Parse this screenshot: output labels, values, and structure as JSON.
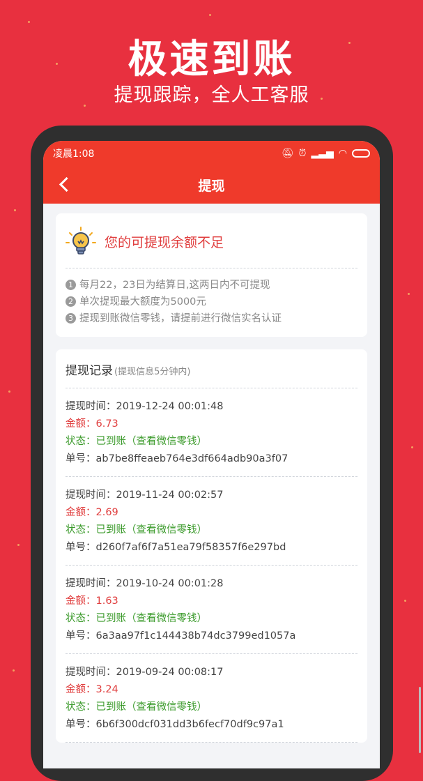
{
  "promo": {
    "title": "极速到账",
    "subtitle": "提现跟踪，全人工客服"
  },
  "statusbar": {
    "time": "凌晨1:08"
  },
  "navbar": {
    "title": "提现"
  },
  "notice": {
    "title": "您的可提现余额不足",
    "rules": [
      {
        "num": "1",
        "text": "每月22，23日为结算日,这两日内不可提现"
      },
      {
        "num": "2",
        "text": "单次提现最大额度为5000元"
      },
      {
        "num": "3",
        "text": "提现到账微信零钱，请提前进行微信实名认证"
      }
    ]
  },
  "records": {
    "title": "提现记录",
    "note": "(提现信息5分钟内)",
    "items": [
      {
        "time": "提现时间：2019-12-24 00:01:48",
        "amount": "金额：6.73",
        "status": "状态：已到账（查看微信零钱）",
        "order": "单号：ab7be8ffeaeb764e3df664adb90a3f07"
      },
      {
        "time": "提现时间：2019-11-24 00:02:57",
        "amount": "金额：2.69",
        "status": "状态：已到账（查看微信零钱）",
        "order": "单号：d260f7af6f7a51ea79f58357f6e297bd"
      },
      {
        "time": "提现时间：2019-10-24 00:01:28",
        "amount": "金额：1.63",
        "status": "状态：已到账（查看微信零钱）",
        "order": "单号：6a3aa97f1c144438b74dc3799ed1057a"
      },
      {
        "time": "提现时间：2019-09-24 00:08:17",
        "amount": "金额：3.24",
        "status": "状态：已到账（查看微信零钱）",
        "order": "单号：6b6f300dcf031dd3b6fecf70df9c97a1"
      }
    ]
  },
  "colors": {
    "brand_red": "#ef3a2b",
    "background_red": "#e8303f",
    "amount_red": "#e03e3e",
    "status_green": "#3a9a2a"
  }
}
